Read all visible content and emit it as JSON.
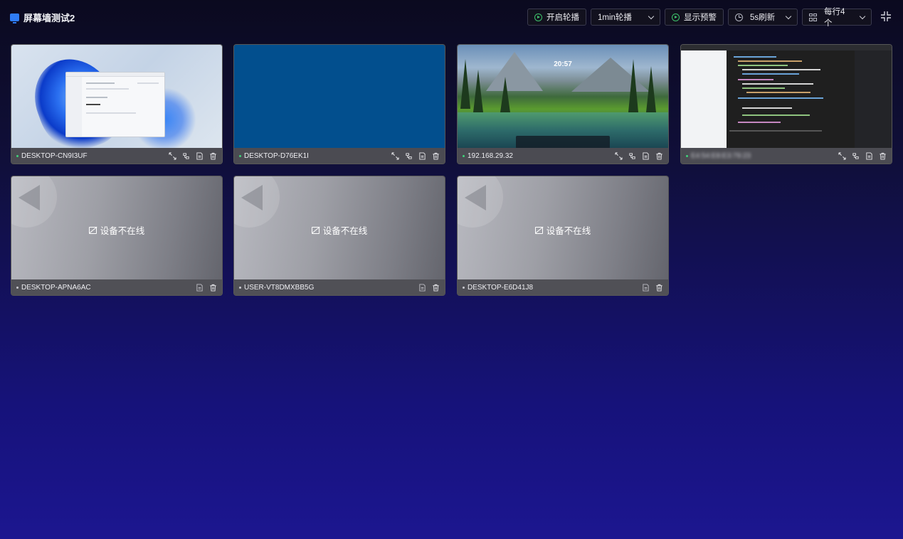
{
  "app": {
    "title": "屏幕墙测试2",
    "accent_color": "#2f7cf6",
    "online_dot_color": "#3fd27a"
  },
  "toolbar": {
    "rotation_toggle_label": "开启轮播",
    "rotation_interval": "1min轮播",
    "show_alerts_label": "显示预警",
    "refresh_interval": "5s刷新",
    "per_row": "每行4个"
  },
  "devices": [
    {
      "name": "DESKTOP-CN9I3UF",
      "online": true
    },
    {
      "name": "DESKTOP-D76EK1I",
      "online": true
    },
    {
      "name": "192.168.29.32",
      "online": true,
      "screen_clock": "20:57"
    },
    {
      "name": "E4:54:E8:E3:79:23",
      "online": true
    },
    {
      "name": "DESKTOP-APNA6AC",
      "online": false,
      "status": "设备不在线"
    },
    {
      "name": "USER-VT8DMXBB5G",
      "online": false,
      "status": "设备不在线"
    },
    {
      "name": "DESKTOP-E6D41J8",
      "online": false,
      "status": "设备不在线"
    }
  ]
}
